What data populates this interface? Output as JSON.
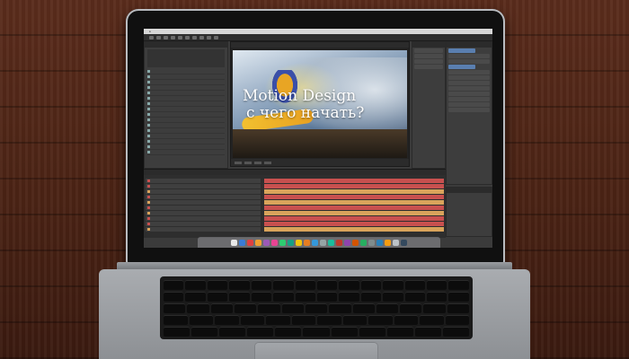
{
  "composition": {
    "headline_line1": "Motion Design",
    "headline_line2": "с чего начать?"
  },
  "layers": [
    {
      "color": "#c8504f"
    },
    {
      "color": "#c8504f"
    },
    {
      "color": "#d9a35b"
    },
    {
      "color": "#c8504f"
    },
    {
      "color": "#d9a35b"
    },
    {
      "color": "#c8504f"
    },
    {
      "color": "#d9a35b"
    },
    {
      "color": "#c8504f"
    },
    {
      "color": "#c8504f"
    },
    {
      "color": "#d9a35b"
    }
  ],
  "dock_icons": [
    "#e8e8e8",
    "#3a7bd5",
    "#e04040",
    "#f0a030",
    "#9b59b6",
    "#e84393",
    "#2ecc71",
    "#16a085",
    "#f1c40f",
    "#e67e22",
    "#3498db",
    "#95a5a6",
    "#1abc9c",
    "#c0392b",
    "#8e44ad",
    "#d35400",
    "#27ae60",
    "#7f8c8d",
    "#2980b9",
    "#f39c12",
    "#bdc3c7",
    "#34495e"
  ],
  "colors": {
    "wood": "#4b2315",
    "ui_panel": "#3d3d3d",
    "track_red": "#c8504f",
    "track_tan": "#d9a35b"
  }
}
